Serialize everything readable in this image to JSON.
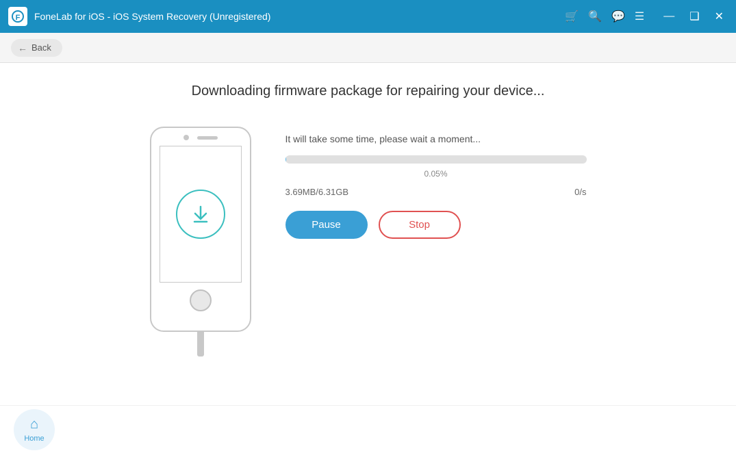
{
  "titleBar": {
    "title": "FoneLab for iOS - iOS System Recovery (Unregistered)",
    "iconLabel": "F",
    "icons": [
      "cart-icon",
      "search-icon",
      "chat-icon",
      "menu-icon"
    ],
    "windowControls": [
      "minimize-icon",
      "maximize-icon",
      "close-icon"
    ],
    "minimizeLabel": "—",
    "maximizeLabel": "❑",
    "closeLabel": "✕"
  },
  "navBar": {
    "backLabel": "Back"
  },
  "main": {
    "pageTitle": "Downloading firmware package for repairing your device...",
    "waitText": "It will take some time, please wait a moment...",
    "progressPercent": 0.05,
    "progressLabel": "0.05%",
    "downloadedSize": "3.69MB/6.31GB",
    "downloadSpeed": "0/s",
    "pauseLabel": "Pause",
    "stopLabel": "Stop"
  },
  "bottomBar": {
    "homeLabel": "Home"
  }
}
